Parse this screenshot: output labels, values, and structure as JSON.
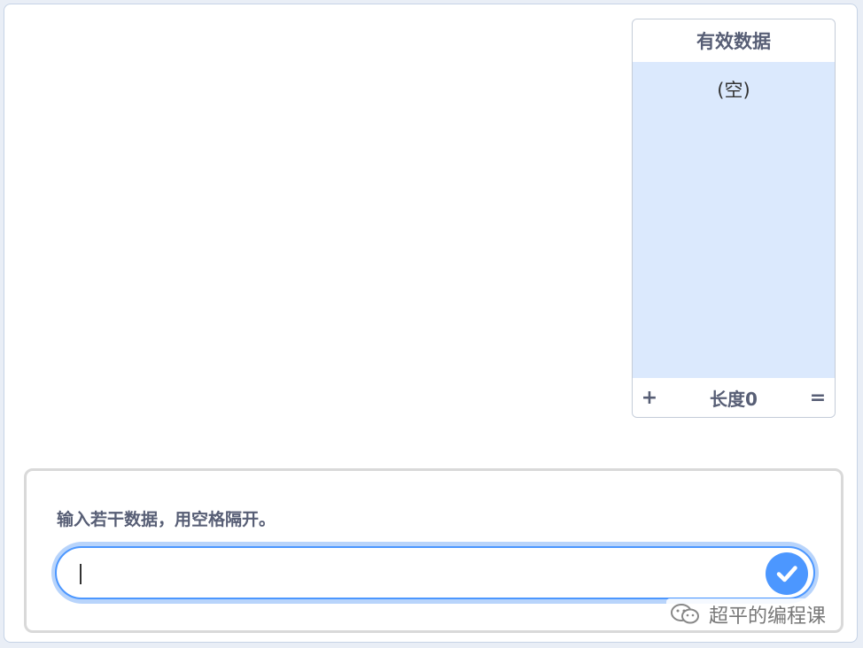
{
  "list_monitor": {
    "title": "有效数据",
    "empty_text": "(空)",
    "add_label": "+",
    "length_label": "长度0",
    "resize_label": "="
  },
  "ask": {
    "question": "输入若干数据，用空格隔开。",
    "input_value": "",
    "submit_icon": "check-icon"
  },
  "watermark": {
    "icon": "wechat-icon",
    "text": "超平的编程课"
  },
  "colors": {
    "accent": "#4c97ff",
    "list_bg": "#dbe9fd",
    "text_muted": "#575e75"
  }
}
